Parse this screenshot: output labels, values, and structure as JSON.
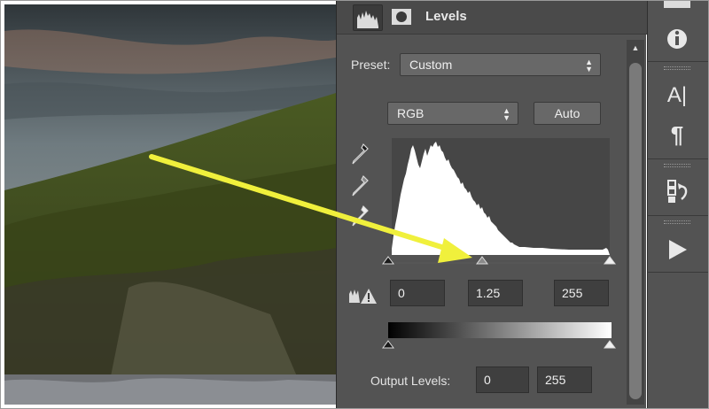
{
  "panel": {
    "title": "Levels",
    "preset_label": "Preset:",
    "preset_value": "Custom",
    "channel_value": "RGB",
    "auto_label": "Auto",
    "input_black": "0",
    "input_gamma": "1.25",
    "input_white": "255",
    "output_label": "Output Levels:",
    "output_black": "0",
    "output_white": "255"
  },
  "toolbar": {
    "char_icon_text": "A|",
    "para_icon_text": "¶"
  },
  "colors": {
    "panel_bg": "#535353",
    "annotation_arrow": "#f0f03c"
  },
  "icons": [
    "adjustment-levels-icon",
    "mask-icon",
    "eyedropper-black-icon",
    "eyedropper-gray-icon",
    "eyedropper-white-icon",
    "clipping-warning-icon",
    "info-icon",
    "character-icon",
    "paragraph-icon",
    "history-icon",
    "play-icon"
  ]
}
